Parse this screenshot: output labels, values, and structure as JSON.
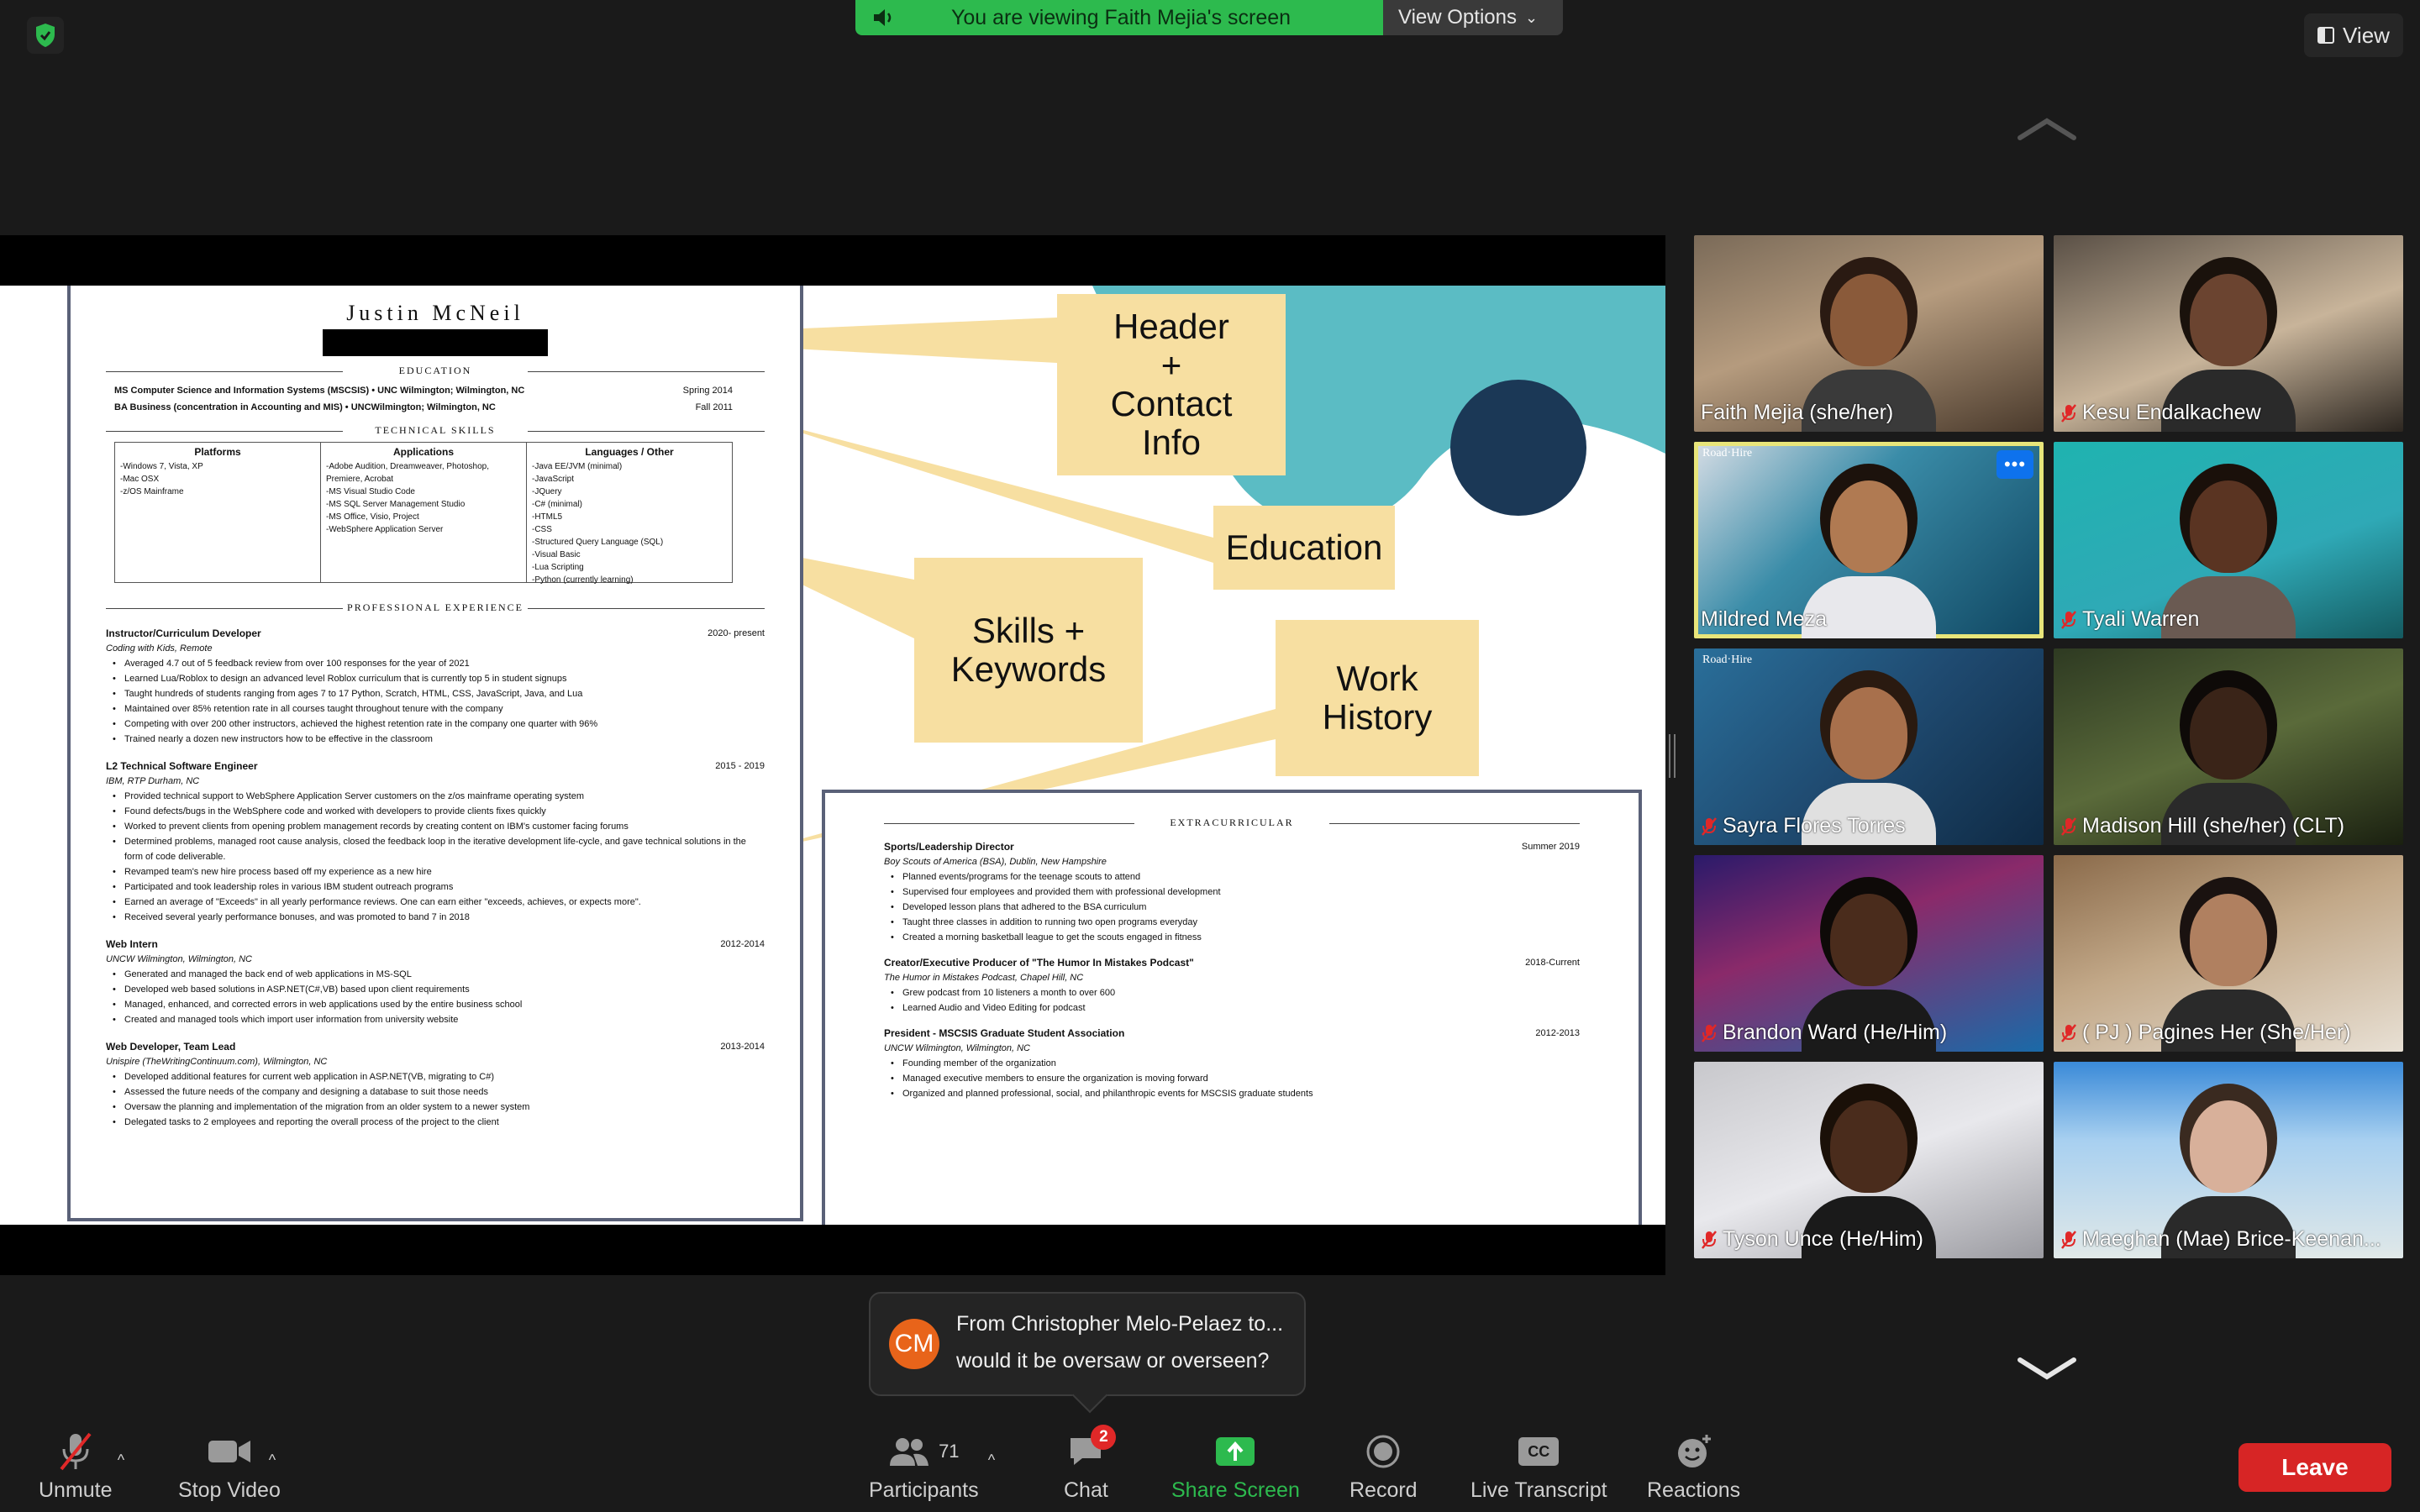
{
  "banner": {
    "viewing_text": "You are viewing Faith Mejia's screen",
    "view_options": "View Options"
  },
  "view_button": "View",
  "resume": {
    "name": "Justin McNeil",
    "education_heading": "EDUCATION",
    "education": [
      {
        "text": "MS Computer Science and Information Systems (MSCSIS) • UNC Wilmington; Wilmington, NC",
        "date": "Spring 2014"
      },
      {
        "text": "BA Business (concentration in Accounting and MIS) • UNCWilmington; Wilmington, NC",
        "date": "Fall 2011"
      }
    ],
    "skills_heading": "TECHNICAL SKILLS",
    "skills_cols": [
      {
        "head": "Platforms",
        "items": "-Windows 7, Vista, XP\n-Mac OSX\n-z/OS Mainframe"
      },
      {
        "head": "Applications",
        "items": "-Adobe Audition, Dreamweaver, Photoshop, Premiere, Acrobat\n-MS Visual Studio Code\n-MS SQL Server Management Studio\n-MS Office, Visio, Project\n-WebSphere Application Server"
      },
      {
        "head": "Languages / Other",
        "items": "-Java EE/JVM (minimal)\n-JavaScript\n-JQuery\n-C# (minimal)\n-HTML5\n-CSS\n-Structured Query Language (SQL)\n-Visual Basic\n-Lua Scripting\n-Python (currently learning)"
      }
    ],
    "experience_heading": "PROFESSIONAL EXPERIENCE",
    "jobs": [
      {
        "title": "Instructor/Curriculum Developer",
        "date": "2020- present",
        "sub": "Coding with Kids, Remote",
        "bullets": [
          "Averaged 4.7 out of 5 feedback review from over 100 responses for the year of 2021",
          "Learned Lua/Roblox to design an advanced level Roblox curriculum that is currently top 5 in student signups",
          "Taught hundreds of students ranging from ages 7 to 17 Python, Scratch, HTML, CSS, JavaScript, Java, and Lua",
          "Maintained over 85% retention rate in all courses taught throughout tenure with the company",
          "Competing with over 200 other instructors, achieved the highest retention rate in the company one quarter with 96%",
          "Trained nearly a dozen new instructors how to be effective in the classroom"
        ]
      },
      {
        "title": "L2 Technical Software Engineer",
        "date": "2015 - 2019",
        "sub": "IBM, RTP Durham, NC",
        "bullets": [
          "Provided technical support to WebSphere Application Server customers on the z/os mainframe operating system",
          "Found defects/bugs in the WebSphere code and worked with developers to provide clients fixes quickly",
          "Worked to prevent clients from opening problem management records by creating content on IBM's customer facing forums",
          "Determined problems, managed root cause analysis, closed the feedback loop in the iterative development life-cycle, and gave technical solutions in the form of code deliverable.",
          "Revamped team's new hire process based off my experience as a new hire",
          "Participated and took leadership roles in various IBM student outreach programs",
          "Earned an average of \"Exceeds\" in all yearly performance reviews. One can earn either \"exceeds, achieves, or expects more\".",
          "Received several yearly performance bonuses, and was promoted to band 7 in 2018"
        ]
      },
      {
        "title": "Web Intern",
        "date": "2012-2014",
        "sub": "UNCW Wilmington, Wilmington, NC",
        "bullets": [
          "Generated and managed the back end of web applications in MS-SQL",
          "Developed web based solutions in ASP.NET(C#,VB) based upon client requirements",
          "Managed, enhanced, and corrected errors in web applications used by the entire business school",
          "Created and managed tools which import user information from university website"
        ]
      },
      {
        "title": "Web Developer, Team Lead",
        "date": "2013-2014",
        "sub": "Unispire (TheWritingContinuum.com), Wilmington, NC",
        "bullets": [
          "Developed additional features for current web application in ASP.NET(VB, migrating to C#)",
          "Assessed the future needs of the company and designing a database to suit those needs",
          "Oversaw the planning and implementation of the migration from an older system to a newer system",
          "Delegated tasks to 2 employees and reporting the overall process of the project to the client"
        ]
      }
    ]
  },
  "extracurricular": {
    "heading": "EXTRACURRICULAR",
    "items": [
      {
        "title": "Sports/Leadership Director",
        "date": "Summer 2019",
        "sub": "Boy Scouts of America (BSA), Dublin, New Hampshire",
        "bullets": [
          "Planned events/programs for the teenage scouts to attend",
          "Supervised four employees and provided them with professional development",
          "Developed lesson plans that adhered to the BSA curriculum",
          "Taught three classes in addition to running two open programs everyday",
          "Created a morning basketball league to get the scouts engaged in fitness"
        ]
      },
      {
        "title": "Creator/Executive Producer of \"The Humor In Mistakes Podcast\"",
        "date": "2018-Current",
        "sub": "The Humor in Mistakes Podcast, Chapel Hill, NC",
        "bullets": [
          "Grew podcast from 10 listeners a month to over 600",
          "Learned Audio and Video Editing for podcast"
        ]
      },
      {
        "title": "President - MSCSIS Graduate Student Association",
        "date": "2012-2013",
        "sub": "UNCW Wilmington, Wilmington, NC",
        "bullets": [
          "Founding member of the organization",
          "Managed executive members to ensure the organization is moving forward",
          "Organized and planned professional, social, and philanthropic events for MSCSIS graduate students"
        ]
      }
    ]
  },
  "callouts": {
    "header": "Header\n+\nContact\nInfo",
    "education": "Education",
    "skills": "Skills +\nKeywords",
    "work": "Work\nHistory"
  },
  "participants": [
    {
      "name": "Faith Mejia  (she/her)",
      "muted": false
    },
    {
      "name": "Kesu Endalkachew",
      "muted": true
    },
    {
      "name": "Mildred Meza",
      "muted": false
    },
    {
      "name": "Tyali Warren",
      "muted": true
    },
    {
      "name": "Sayra Flores Torres",
      "muted": true
    },
    {
      "name": "Madison Hill (she/her) (CLT)",
      "muted": true
    },
    {
      "name": "Brandon Ward (He/Him)",
      "muted": true
    },
    {
      "name": "( PJ ) Pagines Her  (She/Her)",
      "muted": true
    },
    {
      "name": "Tyson Unce  (He/Him)",
      "muted": true
    },
    {
      "name": "Maeghan (Mae) Brice-Keenan...",
      "muted": true
    }
  ],
  "vbg_label": "Road·Hire",
  "chat_toast": {
    "avatar": "CM",
    "from": "From Christopher Melo-Pelaez to...",
    "message": "would it be oversaw or overseen?"
  },
  "toolbar": {
    "unmute": "Unmute",
    "stop_video": "Stop Video",
    "participants": "Participants",
    "participant_count": "71",
    "chat": "Chat",
    "chat_badge": "2",
    "share": "Share Screen",
    "record": "Record",
    "live_transcript": "Live Transcript",
    "reactions": "Reactions",
    "leave": "Leave",
    "cc": "CC"
  },
  "colors": {
    "banner_green": "#2dba4e",
    "leave_red": "#d72525",
    "callout": "#f7dfa1",
    "teal": "#5bbcc4",
    "navy": "#1b3856",
    "active_speaker": "#e8e57a"
  }
}
